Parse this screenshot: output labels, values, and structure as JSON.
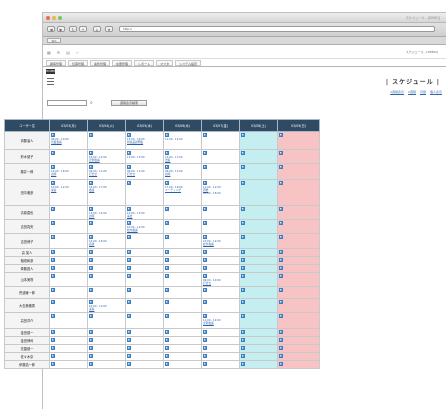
{
  "window": {
    "title": "スケジュール - [DEMO]"
  },
  "browser": {
    "nav_buttons": [
      "◀",
      "▶",
      "↻",
      "+",
      "⌂",
      "★"
    ],
    "address": "http://",
    "bookmark": "bm"
  },
  "app": {
    "icons": [
      "grid-icon",
      "mail-icon",
      "calendar-icon",
      "check-icon"
    ],
    "user_info": "スケジュール - [DEMO]",
    "menu": [
      "顧客管理",
      "伝票管理",
      "案件管理",
      "在庫管理",
      "レポート",
      "マスタ",
      "システム設定"
    ],
    "home_tab": "HOME"
  },
  "page": {
    "title": "| スケジュール |",
    "links": [
      "1週間表示",
      "2週間",
      "月間",
      "個人表示"
    ],
    "search_button": "週間表示検索"
  },
  "table": {
    "user_header": "ユーザー名",
    "day_headers": [
      "03/03(月)",
      "03/04(火)",
      "03/05(水)",
      "03/06(木)",
      "03/07(金)",
      "03/08(土)",
      "03/09(日)"
    ],
    "rows": [
      {
        "name": "齊藤達人",
        "cells": [
          [
            "09:00 - 10:00",
            "営業会議"
          ],
          [],
          [
            "13:00 - 16:00",
            "新商品説明会"
          ],
          [
            "11:00 - 12:00"
          ],
          [],
          [],
          []
        ]
      },
      {
        "name": "鈴木健子",
        "cells": [
          [],
          [
            "10:00 - 12:00",
            "定例会議"
          ],
          [
            "13:00 - 15:00"
          ],
          [
            "13:00 - 17:00",
            "出張"
          ],
          [],
          [],
          []
        ]
      },
      {
        "name": "藤井一郎",
        "cells": [
          [
            "14:00 - 16:00",
            "訪問"
          ],
          [
            "09:00 - 11:00",
            "打合せ"
          ],
          [
            "09:00 - 11:00",
            "打合せ"
          ],
          [
            "09:00 - 11:00",
            "訪問"
          ],
          [],
          [],
          []
        ]
      },
      {
        "name": "田中雅彦",
        "cells": [
          [
            "10:00 - 12:00",
            "来客"
          ],
          [
            "15:00 - 17:00",
            "会議"
          ],
          [],
          [
            "17:00 - 18:00",
            "ミーティング"
          ],
          [
            "11:00 - 12:00",
            "研修",
            "16:00 - 18:00"
          ],
          [],
          []
        ]
      },
      {
        "name": "清原直也",
        "cells": [
          [],
          [
            "13:00 - 14:00",
            "訪問"
          ],
          [
            "13:00 - 15:00",
            "来社"
          ],
          [],
          [],
          [],
          []
        ]
      },
      {
        "name": "吉田真央",
        "cells": [
          [],
          [],
          [
            "10:00 - 12:00",
            "社内会議"
          ],
          [],
          [],
          [],
          []
        ]
      },
      {
        "name": "吉田博子",
        "cells": [
          [],
          [
            "14:00 - 16:00",
            "商談"
          ],
          [],
          [],
          [
            "10:00 - 12:00",
            "社外会議"
          ],
          [],
          []
        ]
      },
      {
        "name": "高 英人",
        "cells": [
          [],
          [],
          [],
          [],
          [],
          [],
          []
        ]
      },
      {
        "name": "稲垣和彦",
        "cells": [
          [],
          [],
          [],
          [],
          [],
          [],
          []
        ]
      },
      {
        "name": "斉藤昌人",
        "cells": [
          [],
          [],
          [],
          [],
          [],
          [],
          []
        ]
      },
      {
        "name": "山本美咲",
        "cells": [
          [],
          [],
          [],
          [],
          [
            "09:00 - 10:00",
            "打合せ"
          ],
          [],
          []
        ]
      },
      {
        "name": "荒波綾一郎",
        "cells": [
          [],
          [],
          [],
          [],
          [],
          [],
          []
        ]
      },
      {
        "name": "大石美穂香",
        "cells": [
          [],
          [
            "10:00 - 12:00",
            "来客"
          ],
          [],
          [],
          [],
          [],
          []
        ]
      },
      {
        "name": "高田洋介",
        "cells": [
          [],
          [],
          [],
          [],
          [
            "11:00 - 12:00",
            "定例会議"
          ],
          [],
          []
        ]
      },
      {
        "name": "金田健一",
        "cells": [
          [],
          [],
          [],
          [],
          [],
          [],
          []
        ]
      },
      {
        "name": "金田博司",
        "cells": [
          [],
          [],
          [],
          [],
          [],
          [],
          []
        ]
      },
      {
        "name": "花園健一",
        "cells": [
          [],
          [],
          [],
          [],
          [],
          [],
          []
        ]
      },
      {
        "name": "佐々木京",
        "cells": [
          [],
          [],
          [],
          [],
          [],
          [],
          []
        ]
      },
      {
        "name": "伊藤浩一郎",
        "cells": [
          [],
          [],
          [],
          [],
          [],
          [],
          []
        ]
      }
    ]
  },
  "colors": {
    "header": "#2f4a63",
    "saturday": "#c5eef0",
    "sunday": "#f8c3c4",
    "link": "#2a5ea8"
  }
}
